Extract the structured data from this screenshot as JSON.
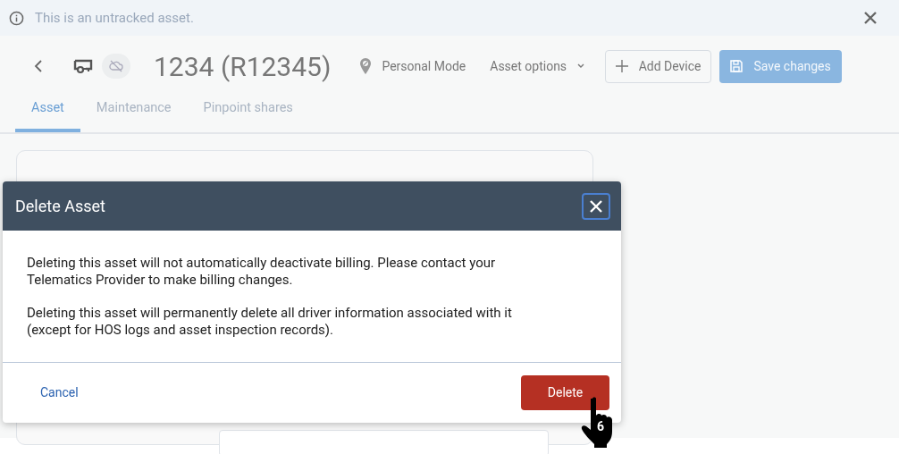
{
  "banner": {
    "text": "This is an untracked asset."
  },
  "header": {
    "title": "1234 (R12345)",
    "mode": "Personal Mode",
    "options": "Asset options",
    "add_device": "Add Device",
    "save": "Save changes",
    "save_disabled": true
  },
  "tabs": [
    {
      "label": "Asset",
      "selected": true
    },
    {
      "label": "Maintenance",
      "selected": false
    },
    {
      "label": "Pinpoint shares",
      "selected": false
    }
  ],
  "dialog": {
    "title": "Delete Asset",
    "paragraphs": [
      "Deleting this asset will not automatically deactivate billing. Please contact your Telematics Provider to make billing changes.",
      "Deleting this asset will permanently delete all driver information associated with it (except for HOS logs and asset inspection records)."
    ],
    "cancel": "Cancel",
    "confirm": "Delete"
  },
  "cursor": {
    "step": "6"
  }
}
